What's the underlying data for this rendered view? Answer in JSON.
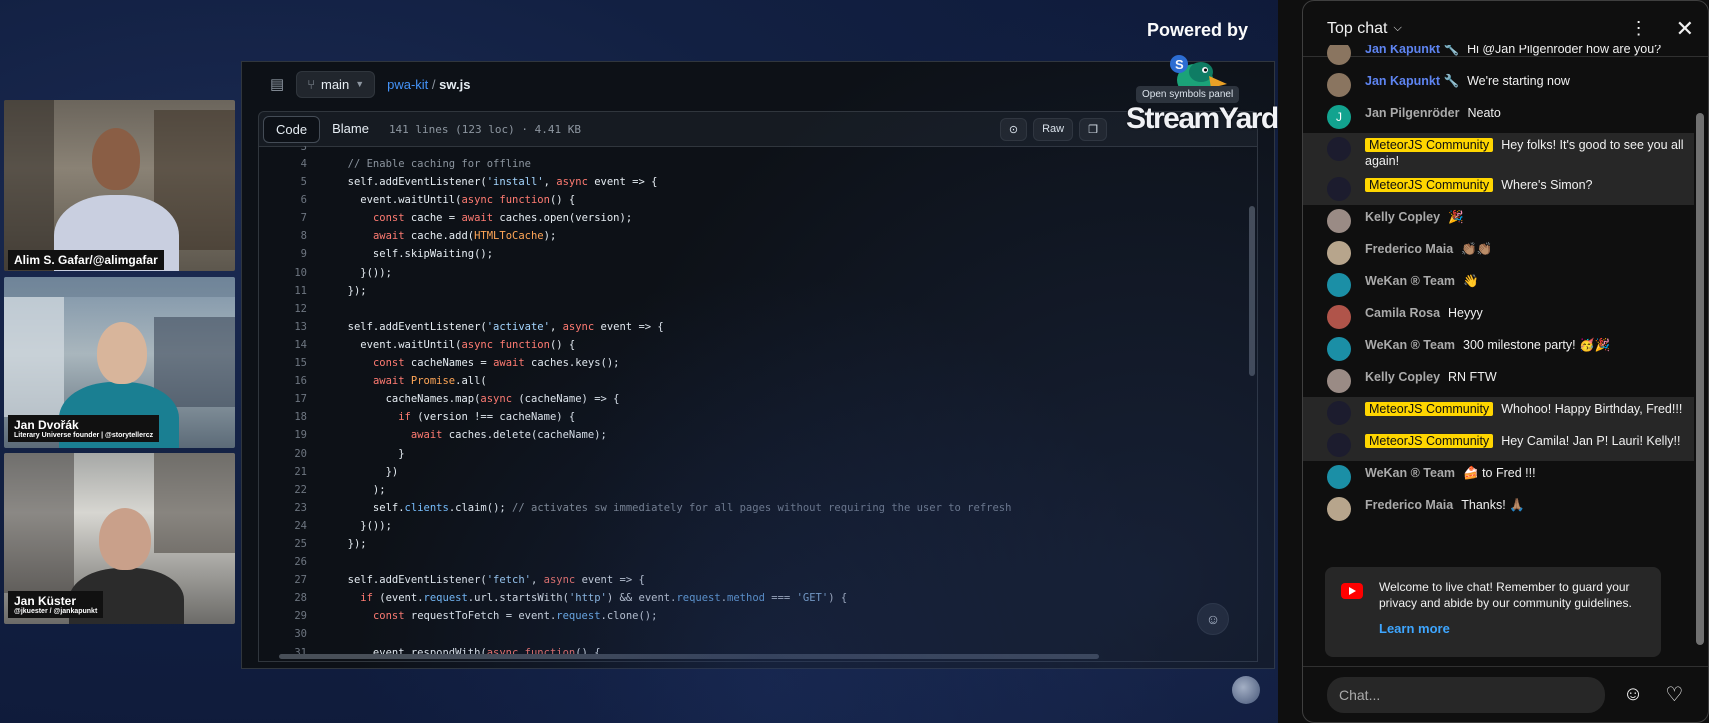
{
  "stage": {
    "powered_by": "Powered by",
    "brand": "StreamYard",
    "tooltip": "Open symbols panel"
  },
  "cameras": [
    {
      "name": "Alim S. Gafar/@alimgafar",
      "subtitle": ""
    },
    {
      "name": "Jan Dvořák",
      "subtitle": "Literary Universe founder | @storytellercz"
    },
    {
      "name": "Jan Küster",
      "subtitle": "@jkuester / @jankapunkt"
    }
  ],
  "code": {
    "branch": "main",
    "repo": "pwa-kit",
    "separator": "/",
    "file": "sw.js",
    "tab_code": "Code",
    "tab_blame": "Blame",
    "file_info": "141 lines (123 loc) · 4.41 KB",
    "raw_label": "Raw",
    "first_partial_line": "3",
    "lines": [
      {
        "n": "4",
        "t": "  // Enable caching for offline"
      },
      {
        "n": "5",
        "t": "  self.addEventListener('install', async event => {"
      },
      {
        "n": "6",
        "t": "    event.waitUntil(async function() {"
      },
      {
        "n": "7",
        "t": "      const cache = await caches.open(version);"
      },
      {
        "n": "8",
        "t": "      await cache.add(HTMLToCache);"
      },
      {
        "n": "9",
        "t": "      self.skipWaiting();"
      },
      {
        "n": "10",
        "t": "    }());"
      },
      {
        "n": "11",
        "t": "  });"
      },
      {
        "n": "12",
        "t": ""
      },
      {
        "n": "13",
        "t": "  self.addEventListener('activate', async event => {"
      },
      {
        "n": "14",
        "t": "    event.waitUntil(async function() {"
      },
      {
        "n": "15",
        "t": "      const cacheNames = await caches.keys();"
      },
      {
        "n": "16",
        "t": "      await Promise.all("
      },
      {
        "n": "17",
        "t": "        cacheNames.map(async (cacheName) => {"
      },
      {
        "n": "18",
        "t": "          if (version !== cacheName) {"
      },
      {
        "n": "19",
        "t": "            await caches.delete(cacheName);"
      },
      {
        "n": "20",
        "t": "          }"
      },
      {
        "n": "21",
        "t": "        })"
      },
      {
        "n": "22",
        "t": "      );"
      },
      {
        "n": "23",
        "t": "      self.clients.claim(); // activates sw immediately for all pages without requiring the user to refresh"
      },
      {
        "n": "24",
        "t": "    }());"
      },
      {
        "n": "25",
        "t": "  });"
      },
      {
        "n": "26",
        "t": ""
      },
      {
        "n": "27",
        "t": "  self.addEventListener('fetch', async event => {"
      },
      {
        "n": "28",
        "t": "    if (event.request.url.startsWith('http') && event.request.method === 'GET') {"
      },
      {
        "n": "29",
        "t": "      const requestToFetch = event.request.clone();"
      },
      {
        "n": "30",
        "t": ""
      },
      {
        "n": "31",
        "t": "      event.respondWith(async function() {"
      }
    ]
  },
  "chat": {
    "title": "Top chat",
    "input_placeholder": "Chat...",
    "messages": [
      {
        "author": "Jan Kapunkt 🔧",
        "type": "owner",
        "text": "Hi @Jan Pilgenröder how are you?",
        "avatar_color": "#8a7560",
        "hl": false
      },
      {
        "author": "Jan Kapunkt 🔧",
        "type": "owner",
        "text": "We're starting now",
        "avatar_color": "#8a7560",
        "hl": false
      },
      {
        "author": "Jan Pilgenröder",
        "type": "normal",
        "text": "Neato",
        "avatar_color": "#12a38f",
        "avatar_letter": "J",
        "hl": false
      },
      {
        "author": "MeteorJS Community",
        "type": "member",
        "text": "Hey folks! It's good to see you all again!",
        "avatar_color": "#1c1c2e",
        "hl": true
      },
      {
        "author": "MeteorJS Community",
        "type": "member",
        "text": "Where's Simon?",
        "avatar_color": "#1c1c2e",
        "hl": true
      },
      {
        "author": "Kelly Copley",
        "type": "normal",
        "text": "🎉",
        "avatar_color": "#9a8b85",
        "hl": false
      },
      {
        "author": "Frederico Maia",
        "type": "normal",
        "text": "👏🏽👏🏽",
        "avatar_color": "#b7a58c",
        "hl": false
      },
      {
        "author": "WeKan ® Team",
        "type": "normal",
        "text": "👋",
        "avatar_color": "#1b8fa6",
        "hl": false
      },
      {
        "author": "Camila Rosa",
        "type": "normal",
        "text": "Heyyy",
        "avatar_color": "#b0544a",
        "hl": false
      },
      {
        "author": "WeKan ® Team",
        "type": "normal",
        "text": "300 milestone party! 🥳🎉",
        "avatar_color": "#1b8fa6",
        "hl": false
      },
      {
        "author": "Kelly Copley",
        "type": "normal",
        "text": "RN FTW",
        "avatar_color": "#9a8b85",
        "hl": false
      },
      {
        "author": "MeteorJS Community",
        "type": "member",
        "text": "Whohoo! Happy Birthday, Fred!!!",
        "avatar_color": "#1c1c2e",
        "hl": true
      },
      {
        "author": "MeteorJS Community",
        "type": "member",
        "text": "Hey Camila! Jan P! Lauri! Kelly!!",
        "avatar_color": "#1c1c2e",
        "hl": true
      },
      {
        "author": "WeKan ® Team",
        "type": "normal",
        "text": "🍰 to Fred !!!",
        "avatar_color": "#1b8fa6",
        "hl": false
      },
      {
        "author": "Frederico Maia",
        "type": "normal",
        "text": "Thanks! 🙏🏽",
        "avatar_color": "#b7a58c",
        "hl": false
      }
    ],
    "welcome_text": "Welcome to live chat! Remember to guard your privacy and abide by our community guidelines.",
    "learn_more": "Learn more"
  },
  "colors": {
    "stage_bg": "#122042",
    "code_bg": "#0d1117",
    "member_badge": "#ffd600",
    "link": "#3ea6ff"
  },
  "icons": [
    "branch-icon",
    "sidebar-icon",
    "copilot-icon",
    "copy-icon",
    "chevron-down-icon",
    "more-vert-icon",
    "close-icon",
    "emoji-icon",
    "heart-icon",
    "youtube-icon"
  ]
}
